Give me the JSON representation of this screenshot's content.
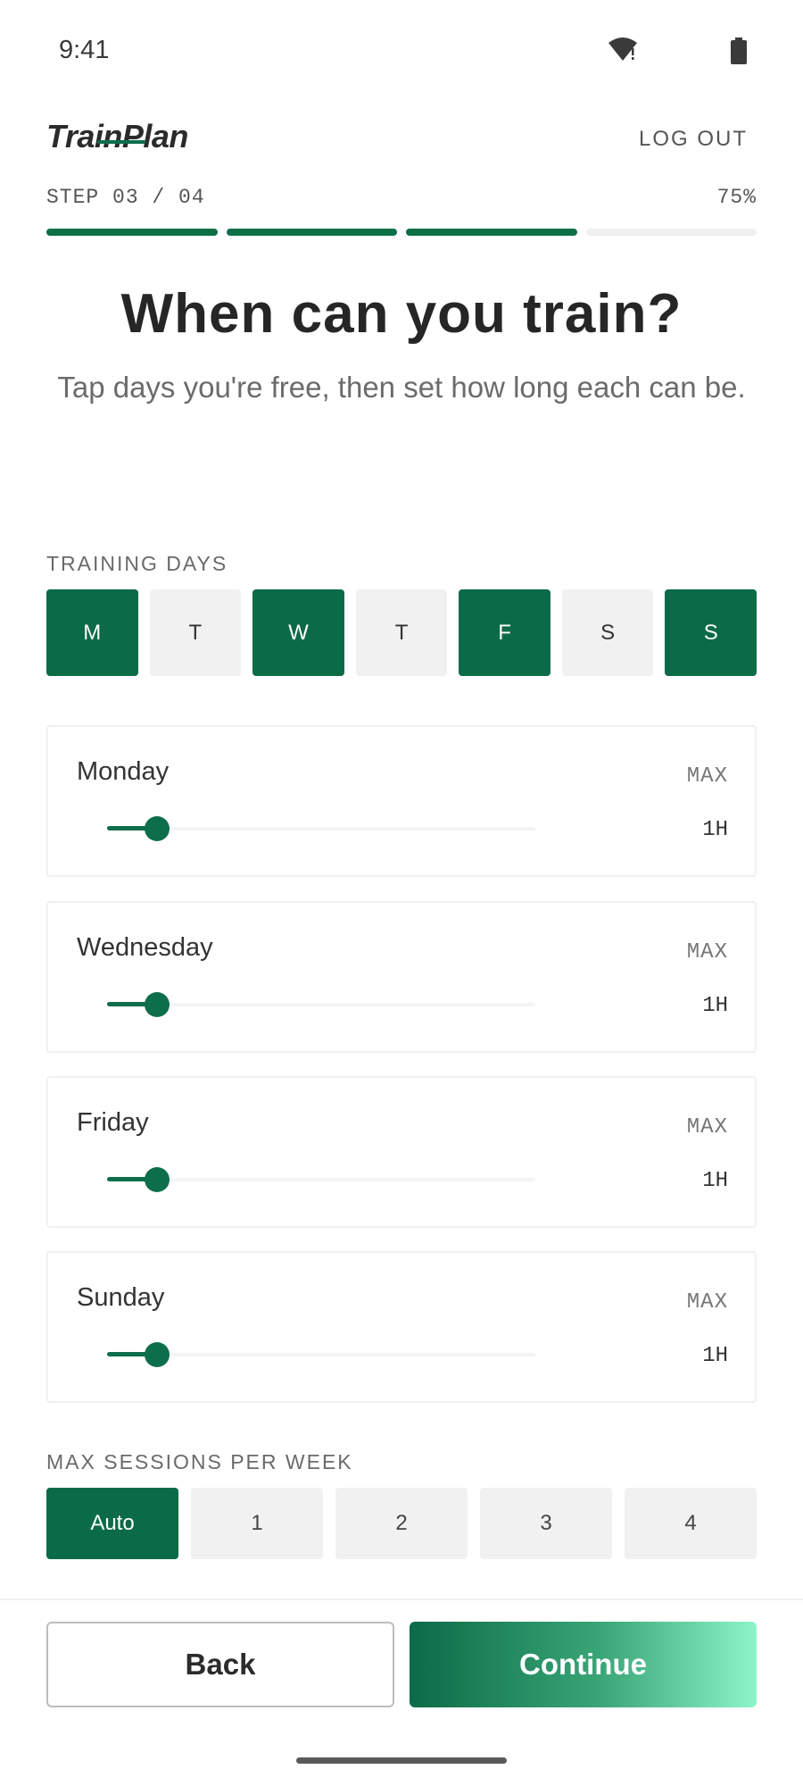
{
  "status": {
    "time": "9:41"
  },
  "header": {
    "logo": "TrainPlan",
    "logout_label": "LOG OUT"
  },
  "progress": {
    "step_label": "STEP 03 / 04",
    "percent_label": "75%",
    "completed_segments": 3,
    "total_segments": 4
  },
  "hero": {
    "title": "When can you train?",
    "subtitle": "Tap days you're free, then set how long each can be."
  },
  "training_days": {
    "label": "TRAINING DAYS",
    "days": [
      {
        "label": "M",
        "selected": true
      },
      {
        "label": "T",
        "selected": false
      },
      {
        "label": "W",
        "selected": true
      },
      {
        "label": "T",
        "selected": false
      },
      {
        "label": "F",
        "selected": true
      },
      {
        "label": "S",
        "selected": false
      },
      {
        "label": "S",
        "selected": true
      }
    ]
  },
  "day_cards": [
    {
      "day": "Monday",
      "max_label": "MAX",
      "value": "1H",
      "slider_fraction": 0.117
    },
    {
      "day": "Wednesday",
      "max_label": "MAX",
      "value": "1H",
      "slider_fraction": 0.117
    },
    {
      "day": "Friday",
      "max_label": "MAX",
      "value": "1H",
      "slider_fraction": 0.117
    },
    {
      "day": "Sunday",
      "max_label": "MAX",
      "value": "1H",
      "slider_fraction": 0.117
    }
  ],
  "sessions": {
    "label": "MAX SESSIONS PER WEEK",
    "options": [
      {
        "label": "Auto",
        "selected": true
      },
      {
        "label": "1",
        "selected": false
      },
      {
        "label": "2",
        "selected": false
      },
      {
        "label": "3",
        "selected": false
      },
      {
        "label": "4",
        "selected": false
      }
    ]
  },
  "footer": {
    "back_label": "Back",
    "continue_label": "Continue"
  },
  "colors": {
    "accent": "#0b6b47",
    "accent_light": "#8df5c8",
    "chip_off": "#f1f1f1"
  },
  "icons": {
    "wifi": "wifi-icon",
    "battery": "battery-icon"
  }
}
